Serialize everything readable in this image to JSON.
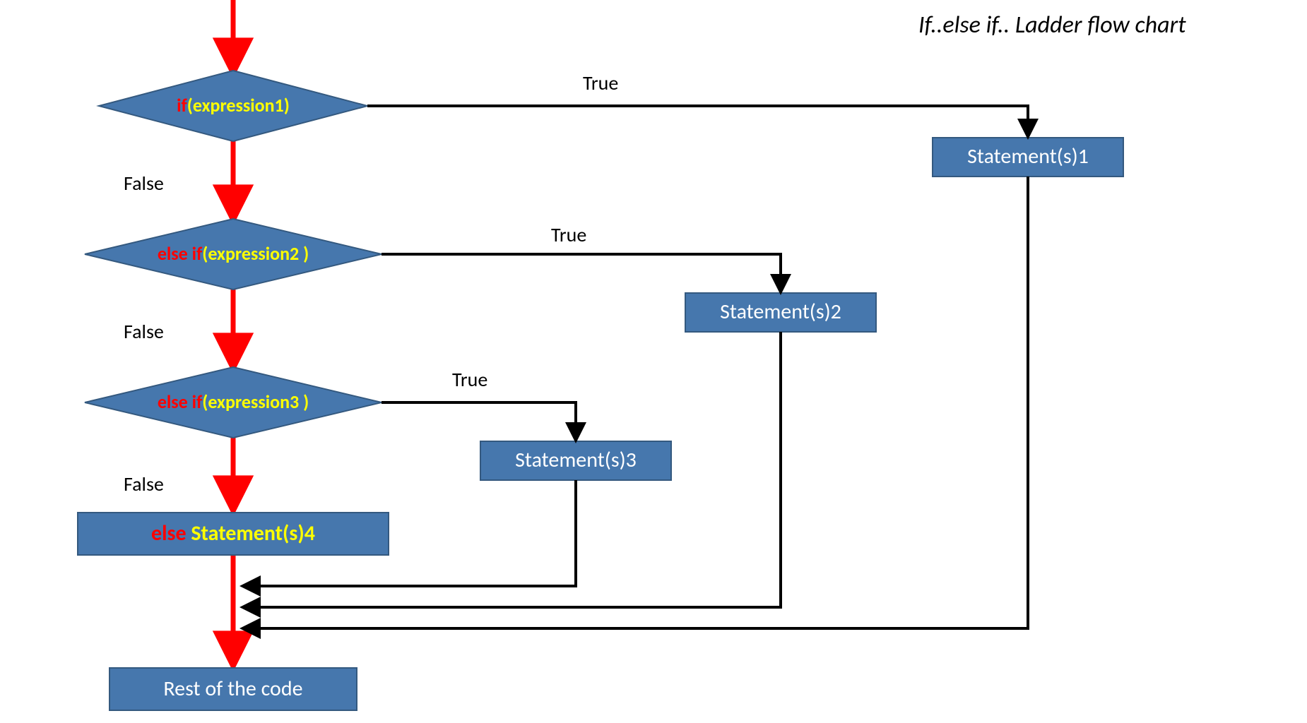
{
  "title": "If..else if.. Ladder flow chart",
  "labels": {
    "true": "True",
    "false": "False"
  },
  "decisions": [
    {
      "keyword": "if",
      "expr": "(expression1)"
    },
    {
      "keyword": "else if",
      "expr": "(expression2 )"
    },
    {
      "keyword": "else if",
      "expr": "(expression3 )"
    }
  ],
  "statements": {
    "s1": "Statement(s)1",
    "s2": "Statement(s)2",
    "s3": "Statement(s)3",
    "else_kw": "else",
    "else_stmt": " Statement(s)4",
    "rest": "Rest of the code"
  },
  "chart_data": {
    "type": "flowchart",
    "title": "If..else if.. Ladder flow chart",
    "nodes": [
      {
        "id": "d1",
        "type": "decision",
        "label": "if(expression1)"
      },
      {
        "id": "d2",
        "type": "decision",
        "label": "else if(expression2)"
      },
      {
        "id": "d3",
        "type": "decision",
        "label": "else if(expression3)"
      },
      {
        "id": "s1",
        "type": "process",
        "label": "Statement(s)1"
      },
      {
        "id": "s2",
        "type": "process",
        "label": "Statement(s)2"
      },
      {
        "id": "s3",
        "type": "process",
        "label": "Statement(s)3"
      },
      {
        "id": "s4",
        "type": "process",
        "label": "else Statement(s)4"
      },
      {
        "id": "rest",
        "type": "terminal",
        "label": "Rest of the code"
      }
    ],
    "edges": [
      {
        "from": "start",
        "to": "d1"
      },
      {
        "from": "d1",
        "to": "s1",
        "label": "True"
      },
      {
        "from": "d1",
        "to": "d2",
        "label": "False"
      },
      {
        "from": "d2",
        "to": "s2",
        "label": "True"
      },
      {
        "from": "d2",
        "to": "d3",
        "label": "False"
      },
      {
        "from": "d3",
        "to": "s3",
        "label": "True"
      },
      {
        "from": "d3",
        "to": "s4",
        "label": "False"
      },
      {
        "from": "s1",
        "to": "rest"
      },
      {
        "from": "s2",
        "to": "rest"
      },
      {
        "from": "s3",
        "to": "rest"
      },
      {
        "from": "s4",
        "to": "rest"
      }
    ]
  }
}
